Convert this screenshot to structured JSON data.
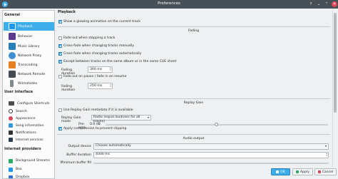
{
  "window": {
    "title": "Preferences",
    "help_glyph": "?",
    "minimize_glyph": "⌄",
    "maximize_glyph": "⌃",
    "close_glyph": "✕"
  },
  "sidebar": {
    "sections": [
      {
        "heading": "General",
        "items": [
          {
            "label": "Playback",
            "selected": true,
            "icon": "play-icon",
            "color": "#1d99f3"
          },
          {
            "label": "Behavior",
            "icon": "behavior-icon",
            "color": "#5c3a8e"
          },
          {
            "label": "Music Library",
            "icon": "music-library-icon",
            "color": "#2980b9"
          },
          {
            "label": "Network Proxy",
            "icon": "network-proxy-icon",
            "color": "#3d8fd1"
          },
          {
            "label": "Transcoding",
            "icon": "transcoding-icon",
            "color": "#e67e22"
          },
          {
            "label": "Network Remote",
            "icon": "network-remote-icon",
            "color": "#444b53"
          },
          {
            "label": "Wiimotedev",
            "icon": "wiimote-icon",
            "color": "#7f8c8d"
          }
        ]
      },
      {
        "heading": "User interface",
        "items": [
          {
            "label": "Configure Shortcuts",
            "icon": "keyboard-icon",
            "color": "#4d4d4d"
          },
          {
            "label": "Search",
            "icon": "search-icon",
            "color": "#31363b"
          },
          {
            "label": "Appearance",
            "icon": "appearance-icon",
            "color": "#da4453"
          },
          {
            "label": "Song information",
            "icon": "song-info-icon",
            "color": "#3498db"
          },
          {
            "label": "Notifications",
            "icon": "notifications-icon",
            "color": "#31363b"
          },
          {
            "label": "Internet services",
            "icon": "internet-services-icon",
            "color": "#2c3e50"
          }
        ]
      },
      {
        "heading": "Internet providers",
        "items": [
          {
            "label": "Background Streams",
            "icon": "background-streams-icon",
            "color": "#27ae60"
          },
          {
            "label": "Box",
            "icon": "box-icon",
            "color": "#1d99f3"
          },
          {
            "label": "Dropbox",
            "icon": "dropbox-icon",
            "color": "#2e6fd8"
          }
        ]
      }
    ]
  },
  "playback": {
    "title": "Playback",
    "glowing_animation": {
      "label": "Show a glowing animation on the current track",
      "checked": true
    },
    "fading": {
      "title": "Fading",
      "fade_out_on_stop": {
        "label": "Fade out when stopping a track",
        "checked": false
      },
      "crossfade_manual": {
        "label": "Cross-fade when changing tracks manually",
        "checked": true
      },
      "crossfade_auto": {
        "label": "Cross-fade when changing tracks automatically",
        "checked": true
      },
      "except_same_album": {
        "label": "Except between tracks on the same album or in the same CUE sheet",
        "checked": true
      },
      "fading_duration_label": "Fading duration",
      "fading_duration_value": "300 ms",
      "fade_pause_resume": {
        "label": "Fade out on pause / fade in on resume",
        "checked": false
      },
      "pause_fading_duration_label": "Fading duration",
      "pause_fading_duration_value": "250 ms"
    },
    "replay_gain": {
      "title": "Replay Gain",
      "use_metadata": {
        "label": "Use Replay Gain metadata if it is available",
        "checked": false
      },
      "mode_label": "Replay Gain mode",
      "mode_value": "Radio (equal loudness for all tracks)",
      "preamp_label": "Pre-amp",
      "preamp_value": "0.0 dB",
      "preamp_fraction": 0.5,
      "compression": {
        "label": "Apply compression to prevent clipping",
        "checked": true
      }
    },
    "audio_output": {
      "title": "Audio output",
      "output_device_label": "Output device",
      "output_device_value": "Choose automatically",
      "buffer_duration_label": "Buffer duration",
      "buffer_duration_value": "4000 ms",
      "minimum_buffer_fill_label": "Minimum buffer fill"
    }
  },
  "buttons": {
    "ok": "OK",
    "apply": "Apply",
    "cancel": "Cancel"
  },
  "colors": {
    "accent": "#3daee9",
    "titlebar": "#475057",
    "close": "#da4453"
  }
}
